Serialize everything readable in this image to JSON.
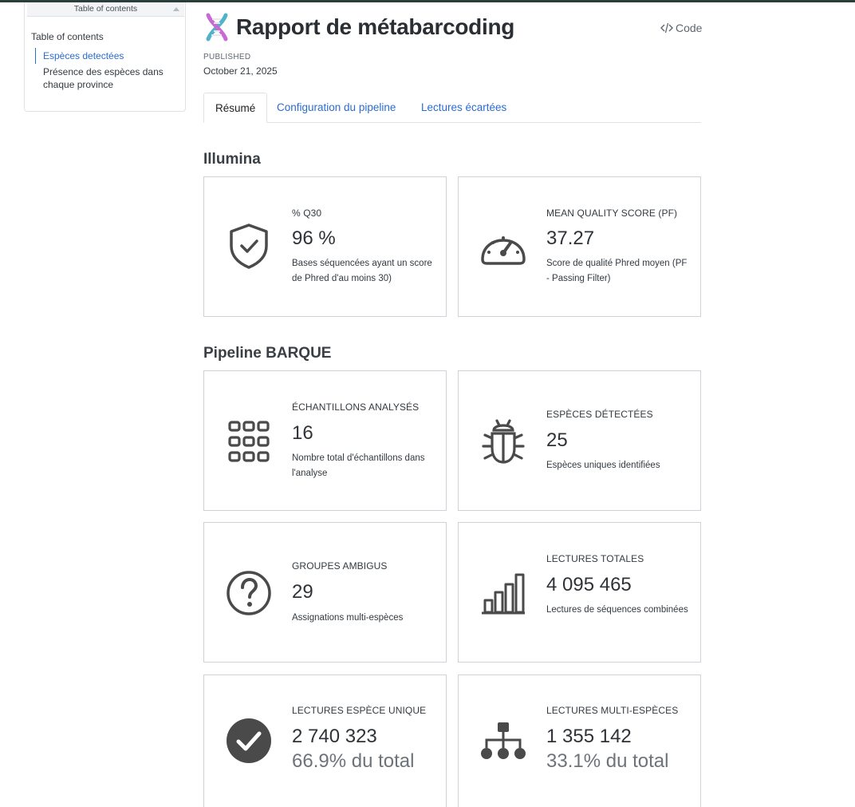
{
  "toc": {
    "header": "Table of contents",
    "title": "Table of contents",
    "items": [
      "Espèces detectées",
      "Présence des espèces dans chaque province"
    ]
  },
  "header": {
    "title": "Rapport de métabarcoding",
    "code_label": "Code",
    "published_label": "PUBLISHED",
    "published_date": "October 21, 2025"
  },
  "tabs": [
    "Résumé",
    "Configuration du pipeline",
    "Lectures écartées"
  ],
  "sections": {
    "illumina": "Illumina",
    "barque": "Pipeline BARQUE"
  },
  "cards": {
    "q30": {
      "icon": "shield-check-icon",
      "label": "% Q30",
      "value": "96 %",
      "desc": "Bases séquencées ayant un score de Phred d'au moins 30)"
    },
    "mean_quality": {
      "icon": "speedometer-icon",
      "label": "MEAN QUALITY SCORE (PF)",
      "value": "37.27",
      "desc": "Score de qualité Phred moyen (PF - Passing Filter)"
    },
    "samples": {
      "icon": "grid-icon",
      "label": "ÉCHANTILLONS ANALYSÉS",
      "value": "16",
      "desc": "Nombre total d'échantillons dans l'analyse"
    },
    "species": {
      "icon": "bug-icon",
      "label": "ESPÈCES DÉTECTÉES",
      "value": "25",
      "desc": "Espèces uniques identifiées"
    },
    "ambiguous": {
      "icon": "question-circle-icon",
      "label": "GROUPES AMBIGUS",
      "value": "29",
      "desc": "Assignations multi-espèces"
    },
    "total_reads": {
      "icon": "bar-chart-icon",
      "label": "LECTURES TOTALES",
      "value": "4 095 465",
      "desc": "Lectures de séquences combinées"
    },
    "unique_reads": {
      "icon": "check-circle-icon",
      "label": "LECTURES ESPÈCE UNIQUE",
      "value": "2 740 323",
      "sub": "66.9% du total"
    },
    "multi_reads": {
      "icon": "diagram-icon",
      "label": "LECTURES MULTI-ESPÈCES",
      "value": "1 355 142",
      "sub": "33.1% du total"
    }
  },
  "colors": {
    "accent": "#2b6cd1",
    "icon": "#4a4a4a",
    "border": "#cfd3d7"
  }
}
